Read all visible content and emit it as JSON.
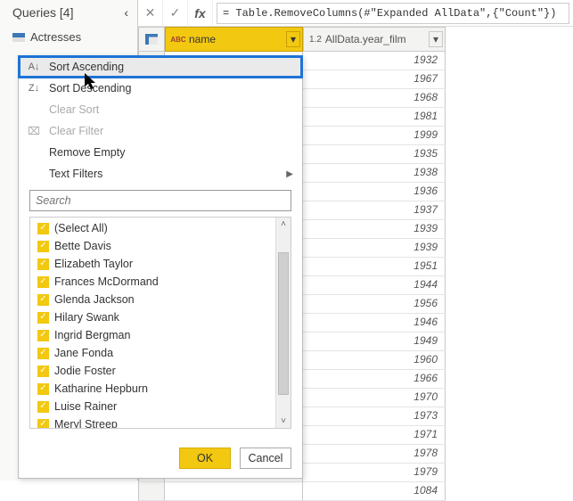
{
  "left_panel": {
    "header": "Queries [4]",
    "item": "Actresses"
  },
  "formula": "= Table.RemoveColumns(#\"Expanded AllData\",{\"Count\"})",
  "columns": {
    "col1": {
      "type": "ABC",
      "label": "name"
    },
    "col2": {
      "type": "1.2",
      "label": "AllData.year_film"
    }
  },
  "years": [
    "1932",
    "1967",
    "1968",
    "1981",
    "1999",
    "1935",
    "1938",
    "1936",
    "1937",
    "1939",
    "1939",
    "1951",
    "1944",
    "1956",
    "1946",
    "1949",
    "1960",
    "1966",
    "1970",
    "1973",
    "1971",
    "1978",
    "1979",
    "1084"
  ],
  "menu": {
    "sort_asc": "Sort Ascending",
    "sort_desc": "Sort Descending",
    "clear_sort": "Clear Sort",
    "clear_filter": "Clear Filter",
    "remove_empty": "Remove Empty",
    "text_filters": "Text Filters",
    "search_placeholder": "Search",
    "items": [
      "(Select All)",
      "Bette Davis",
      "Elizabeth Taylor",
      "Frances McDormand",
      "Glenda Jackson",
      "Hilary Swank",
      "Ingrid Bergman",
      "Jane Fonda",
      "Jodie Foster",
      "Katharine Hepburn",
      "Luise Rainer",
      "Meryl Streep"
    ],
    "ok": "OK",
    "cancel": "Cancel"
  }
}
